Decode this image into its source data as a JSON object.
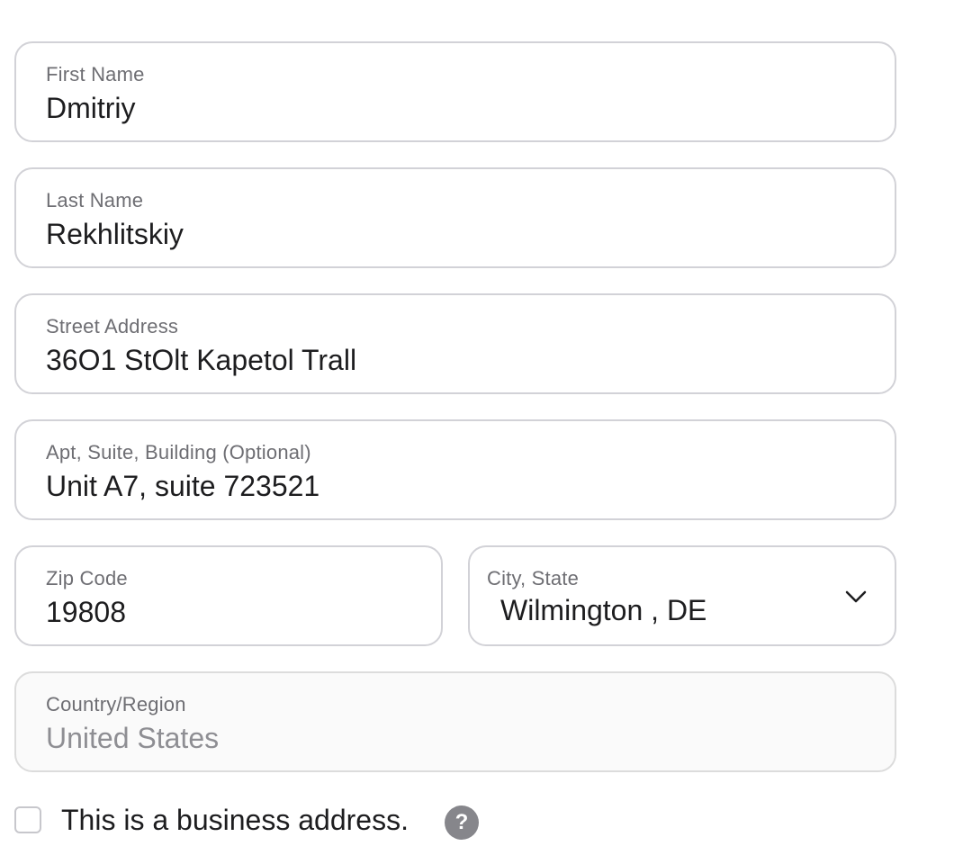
{
  "form": {
    "first_name": {
      "label": "First Name",
      "value": "Dmitriy"
    },
    "last_name": {
      "label": "Last Name",
      "value": "Rekhlitskiy"
    },
    "street_address": {
      "label": "Street Address",
      "value": "36O1 StOlt Kapetol Trall"
    },
    "apt_suite": {
      "label": "Apt, Suite, Building (Optional)",
      "value": "Unit A7, suite 723521"
    },
    "zip_code": {
      "label": "Zip Code",
      "value": "19808"
    },
    "city_state": {
      "label": "City, State",
      "value": "Wilmington , DE",
      "icon": "chevron-down-icon"
    },
    "country": {
      "label": "Country/Region",
      "value": "United States",
      "disabled": true
    },
    "business_address": {
      "label": "This is a business address.",
      "checked": false,
      "help_icon": "?"
    }
  },
  "colors": {
    "border": "#d2d2d7",
    "label": "#6e6e73",
    "text": "#1d1d1f",
    "disabled_text": "#8e8e93",
    "help_icon_bg": "#86868b"
  }
}
